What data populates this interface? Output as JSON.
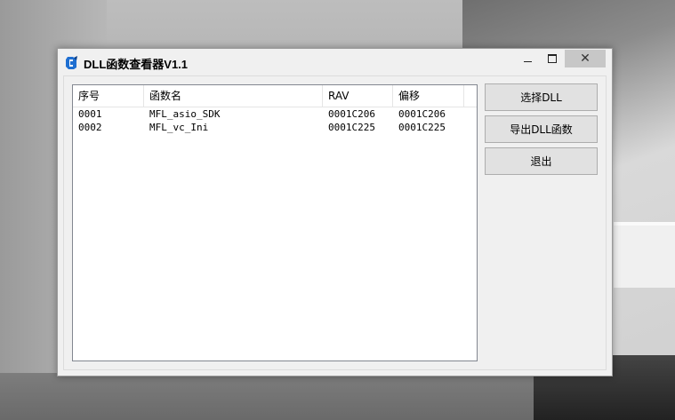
{
  "window": {
    "title": "DLL函数查看器V1.1",
    "controls": {
      "minimize": "minimize-icon",
      "maximize": "maximize-icon",
      "close": "✕"
    }
  },
  "list": {
    "columns": [
      "序号",
      "函数名",
      "RAV",
      "偏移"
    ],
    "rows": [
      [
        "0001",
        "MFL_asio_SDK",
        "0001C206",
        "0001C206"
      ],
      [
        "0002",
        "MFL_vc_Ini",
        "0001C225",
        "0001C225"
      ]
    ]
  },
  "buttons": {
    "select_dll": "选择DLL",
    "export_dll": "导出DLL函数",
    "exit": "退出"
  },
  "colors": {
    "window_bg": "#f0f0f0",
    "close_button_bg": "#c7c7c7",
    "button_bg": "#e1e1e1",
    "icon_blue": "#1f6fd1"
  }
}
